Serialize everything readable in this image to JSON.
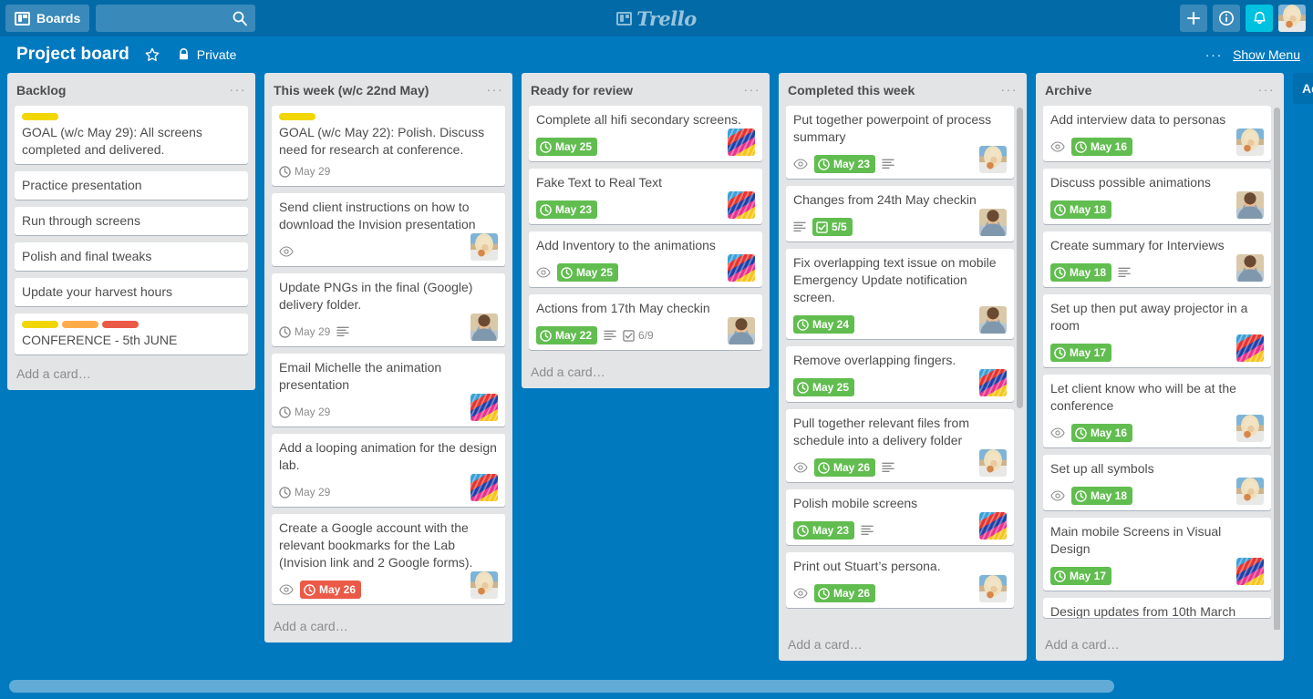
{
  "topbar": {
    "boards_label": "Boards",
    "search_placeholder": "",
    "search_value": "",
    "logo_text": "Trello",
    "icons": {
      "boards": "boards-icon",
      "search": "search-icon",
      "add": "plus-icon",
      "info": "info-icon",
      "notifications": "bell-icon",
      "avatar": "user-avatar"
    }
  },
  "board_header": {
    "title": "Project board",
    "star_label": "star-icon",
    "visibility": "Private",
    "menu_dots": "···",
    "show_menu": "Show Menu"
  },
  "add_list_label": "Add a list…",
  "add_card_label": "Add a card…",
  "list_menu_dots": "···",
  "colors": {
    "top_bar": "#026aa7",
    "board_bg": "#0079bf",
    "list_bg": "#e2e4e6",
    "card_bg": "#ffffff",
    "due_green": "#61bd4f",
    "due_red": "#eb5a46",
    "label_yellow": "#f2d600",
    "label_orange": "#ffab4a",
    "label_red": "#eb5a46",
    "alert_highlight": "#00c2e0"
  },
  "lists": [
    {
      "name": "Backlog",
      "scroll": false,
      "cards": [
        {
          "title": "GOAL (w/c May 29): All screens completed and delivered.",
          "labels": [
            "label_yellow"
          ],
          "badges": [],
          "member": null
        },
        {
          "title": "Practice presentation",
          "labels": [],
          "badges": [],
          "member": null
        },
        {
          "title": "Run through screens",
          "labels": [],
          "badges": [],
          "member": null
        },
        {
          "title": "Polish and final tweaks",
          "labels": [],
          "badges": [],
          "member": null
        },
        {
          "title": "Update your harvest hours",
          "labels": [],
          "badges": [],
          "member": null
        },
        {
          "title": "CONFERENCE - 5th JUNE",
          "labels": [
            "label_yellow",
            "label_orange",
            "label_red"
          ],
          "badges": [],
          "member": null
        }
      ]
    },
    {
      "name": "This week (w/c 22nd May)",
      "scroll": false,
      "cards": [
        {
          "title": "GOAL (w/c May 22): Polish. Discuss need for research at conference.",
          "labels": [
            "label_yellow"
          ],
          "badges": [
            {
              "type": "due",
              "text": "May 29",
              "state": "none"
            }
          ],
          "member": null
        },
        {
          "title": "Send client instructions on how to download the Invision presentation",
          "labels": [],
          "badges": [
            {
              "type": "watch"
            }
          ],
          "member": "hat"
        },
        {
          "title": "Update PNGs in the final (Google) delivery folder.",
          "labels": [],
          "badges": [
            {
              "type": "due",
              "text": "May 29",
              "state": "none"
            },
            {
              "type": "description"
            }
          ],
          "member": "man"
        },
        {
          "title": "Email Michelle the animation presentation",
          "labels": [],
          "badges": [
            {
              "type": "due",
              "text": "May 29",
              "state": "none"
            }
          ],
          "member": "lego"
        },
        {
          "title": "Add a looping animation for the design lab.",
          "labels": [],
          "badges": [
            {
              "type": "due",
              "text": "May 29",
              "state": "none"
            }
          ],
          "member": "lego"
        },
        {
          "title": "Create a Google account with the relevant bookmarks for the Lab (Invision link and 2 Google forms).",
          "labels": [],
          "badges": [
            {
              "type": "watch"
            },
            {
              "type": "due",
              "text": "May 26",
              "state": "red"
            }
          ],
          "member": "hat"
        }
      ]
    },
    {
      "name": "Ready for review",
      "scroll": false,
      "cards": [
        {
          "title": "Complete all hifi secondary screens.",
          "labels": [],
          "badges": [
            {
              "type": "due",
              "text": "May 25",
              "state": "green"
            }
          ],
          "member": "lego"
        },
        {
          "title": "Fake Text to Real Text",
          "labels": [],
          "badges": [
            {
              "type": "due",
              "text": "May 23",
              "state": "green"
            }
          ],
          "member": "lego"
        },
        {
          "title": "Add Inventory to the animations",
          "labels": [],
          "badges": [
            {
              "type": "watch"
            },
            {
              "type": "due",
              "text": "May 25",
              "state": "green"
            }
          ],
          "member": "lego"
        },
        {
          "title": "Actions from 17th May checkin",
          "labels": [],
          "badges": [
            {
              "type": "due",
              "text": "May 22",
              "state": "green"
            },
            {
              "type": "description"
            },
            {
              "type": "checklist",
              "text": "6/9",
              "state": "none"
            }
          ],
          "member": "man"
        }
      ]
    },
    {
      "name": "Completed this week",
      "scroll": true,
      "cards": [
        {
          "title": "Put together powerpoint of process summary",
          "labels": [],
          "badges": [
            {
              "type": "watch"
            },
            {
              "type": "due",
              "text": "May 23",
              "state": "green"
            },
            {
              "type": "description"
            }
          ],
          "member": "hat"
        },
        {
          "title": "Changes from 24th May checkin",
          "labels": [],
          "badges": [
            {
              "type": "description"
            },
            {
              "type": "checklist",
              "text": "5/5",
              "state": "done"
            }
          ],
          "member": "man"
        },
        {
          "title": "Fix overlapping text issue on mobile Emergency Update notification screen.",
          "labels": [],
          "badges": [
            {
              "type": "due",
              "text": "May 24",
              "state": "green"
            }
          ],
          "member": "man"
        },
        {
          "title": "Remove overlapping fingers.",
          "labels": [],
          "badges": [
            {
              "type": "due",
              "text": "May 25",
              "state": "green"
            }
          ],
          "member": "lego"
        },
        {
          "title": "Pull together relevant files from schedule into a delivery folder",
          "labels": [],
          "badges": [
            {
              "type": "watch"
            },
            {
              "type": "due",
              "text": "May 26",
              "state": "green"
            },
            {
              "type": "description"
            }
          ],
          "member": "hat"
        },
        {
          "title": "Polish mobile screens",
          "labels": [],
          "badges": [
            {
              "type": "due",
              "text": "May 23",
              "state": "green"
            },
            {
              "type": "description"
            }
          ],
          "member": "lego"
        },
        {
          "title": "Print out Stuart’s persona.",
          "labels": [],
          "badges": [
            {
              "type": "watch"
            },
            {
              "type": "due",
              "text": "May 26",
              "state": "green"
            }
          ],
          "member": "hat"
        }
      ]
    },
    {
      "name": "Archive",
      "scroll": true,
      "cards": [
        {
          "title": "Add interview data to personas",
          "labels": [],
          "badges": [
            {
              "type": "watch"
            },
            {
              "type": "due",
              "text": "May 16",
              "state": "green"
            }
          ],
          "member": "hat"
        },
        {
          "title": "Discuss possible animations",
          "labels": [],
          "badges": [
            {
              "type": "due",
              "text": "May 18",
              "state": "green"
            }
          ],
          "member": "man"
        },
        {
          "title": "Create summary for Interviews",
          "labels": [],
          "badges": [
            {
              "type": "due",
              "text": "May 18",
              "state": "green"
            },
            {
              "type": "description"
            }
          ],
          "member": "man"
        },
        {
          "title": "Set up then put away projector in a room",
          "labels": [],
          "badges": [
            {
              "type": "due",
              "text": "May 17",
              "state": "green"
            }
          ],
          "member": "lego"
        },
        {
          "title": "Let client know who will be at the conference",
          "labels": [],
          "badges": [
            {
              "type": "watch"
            },
            {
              "type": "due",
              "text": "May 16",
              "state": "green"
            }
          ],
          "member": "hat"
        },
        {
          "title": "Set up all symbols",
          "labels": [],
          "badges": [
            {
              "type": "watch"
            },
            {
              "type": "due",
              "text": "May 18",
              "state": "green"
            }
          ],
          "member": "hat"
        },
        {
          "title": "Main mobile Screens in Visual Design",
          "labels": [],
          "badges": [
            {
              "type": "due",
              "text": "May 17",
              "state": "green"
            }
          ],
          "member": "lego"
        },
        {
          "title": "Design updates from 10th March",
          "labels": [],
          "badges": [],
          "member": null,
          "clipped": true
        }
      ]
    }
  ]
}
